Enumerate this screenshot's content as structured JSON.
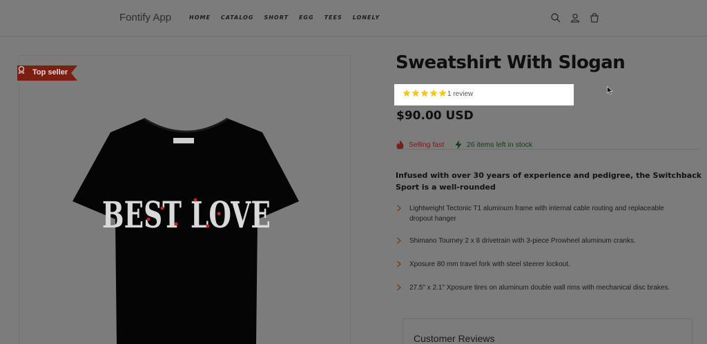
{
  "header": {
    "logo": "Fontify App",
    "nav": [
      "HOME",
      "CATALOG",
      "SHORT",
      "EGG",
      "TEES",
      "LONELY"
    ],
    "icons": [
      "search-icon",
      "account-icon",
      "cart-icon"
    ]
  },
  "media": {
    "badge": "Top seller",
    "badge_icon": "award-icon",
    "badge_color": "#7a1f12",
    "image_alt": "Black t-shirt with BEST LOVE print",
    "shirt_print": "BEST LOVE"
  },
  "product": {
    "title": "Sweatshirt With Slogan",
    "rating": 5,
    "rating_max": 5,
    "review_count": "1 review",
    "price": "$90.00 USD",
    "selling_fast": "Selling fast",
    "stock": "26 items left in stock",
    "description": "Infused with over 30 years of experience and pedigree, the Switchback Sport is a well-rounded",
    "features": [
      "Lightweight Tectonic T1 aluminum frame with internal cable routing and replaceable dropout hanger",
      "Shimano Tourney 2 x 8 drivetrain with 3-piece Prowheel aluminum cranks.",
      "Xposure 80 mm travel fork with steel steerer lockout.",
      "27.5\" x 2.1\" Xposure tires on aluminum double wall rims with mechanical disc brakes."
    ]
  },
  "reviews": {
    "title": "Customer Reviews"
  },
  "colors": {
    "overlay_bg": "#7c7c7c",
    "star": "#f5c518",
    "selling_fast": "#7a1d14",
    "stock": "#0f3d14"
  }
}
